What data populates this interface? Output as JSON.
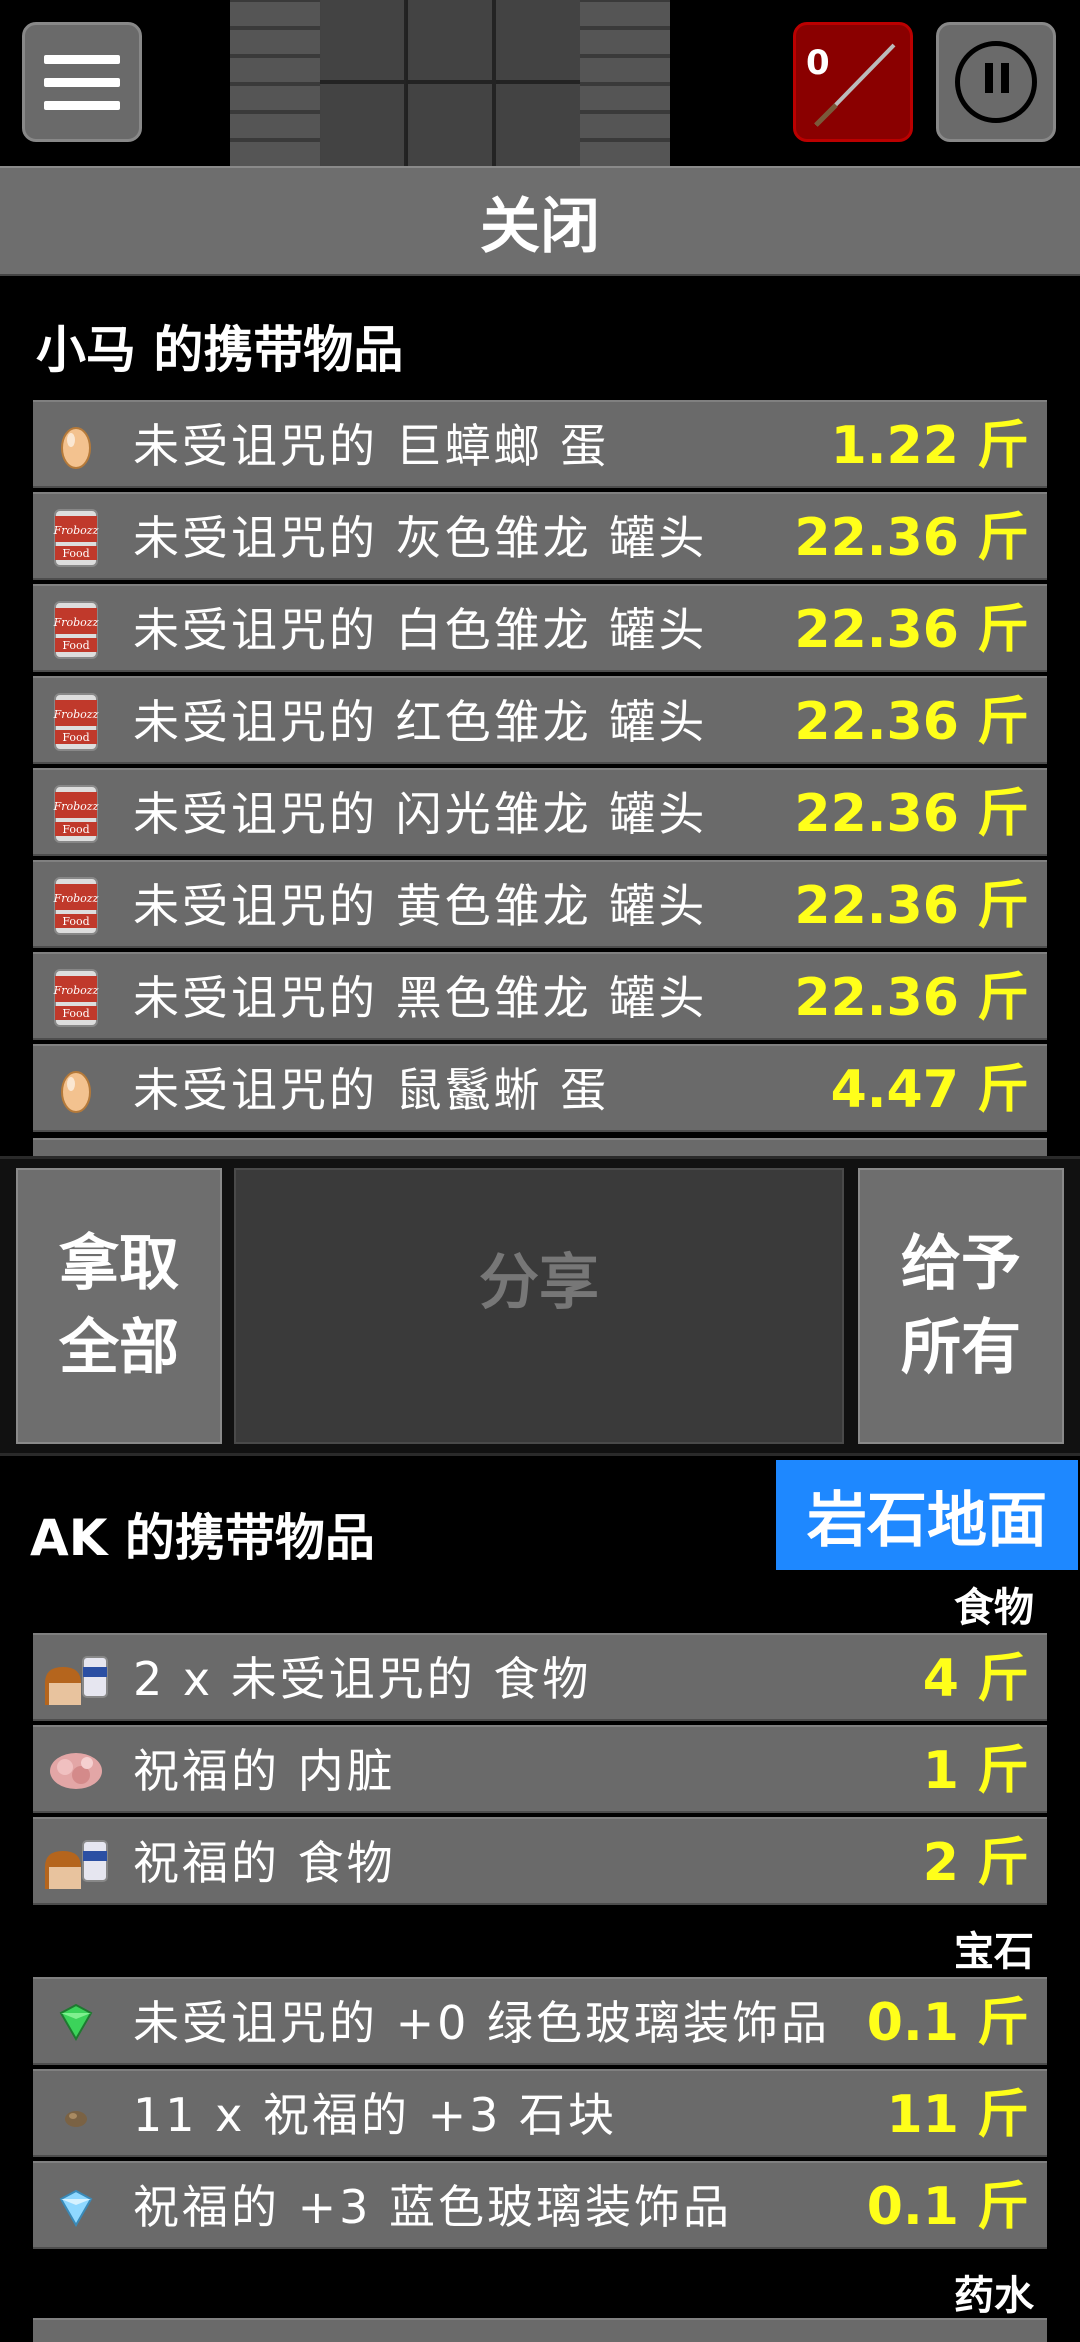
{
  "top_bar": {
    "weapon_count": "0",
    "menu_icon": "hamburger-menu-icon",
    "weapon_icon": "spear-icon",
    "pause_icon": "pause-icon"
  },
  "close_label": "关闭",
  "npc_inventory": {
    "title": "小马 的携带物品",
    "items": [
      {
        "icon": "egg-icon",
        "name": "未受诅咒的 巨蟑螂 蛋",
        "weight": "1.22 斤"
      },
      {
        "icon": "food-can-icon",
        "name": "未受诅咒的 灰色雏龙 罐头",
        "weight": "22.36 斤"
      },
      {
        "icon": "food-can-icon",
        "name": "未受诅咒的 白色雏龙 罐头",
        "weight": "22.36 斤"
      },
      {
        "icon": "food-can-icon",
        "name": "未受诅咒的 红色雏龙 罐头",
        "weight": "22.36 斤"
      },
      {
        "icon": "food-can-icon",
        "name": "未受诅咒的 闪光雏龙 罐头",
        "weight": "22.36 斤"
      },
      {
        "icon": "food-can-icon",
        "name": "未受诅咒的 黄色雏龙 罐头",
        "weight": "22.36 斤"
      },
      {
        "icon": "food-can-icon",
        "name": "未受诅咒的 黑色雏龙 罐头",
        "weight": "22.36 斤"
      },
      {
        "icon": "egg-icon",
        "name": "未受诅咒的 鼠鬣蜥 蛋",
        "weight": "4.47 斤"
      }
    ]
  },
  "actions": {
    "take_all": "拿取全部",
    "share": "分享",
    "give_all": "给予所有"
  },
  "player_inventory": {
    "title": "AK 的携带物品",
    "ground_button": "岩石地面",
    "categories": [
      {
        "label": "食物",
        "items": [
          {
            "icon": "bread-food-icon",
            "name": "2 x 未受诅咒的 食物",
            "weight": "4 斤"
          },
          {
            "icon": "entrails-icon",
            "name": "祝福的 内脏",
            "weight": "1 斤"
          },
          {
            "icon": "bread-food-icon",
            "name": "祝福的 食物",
            "weight": "2 斤"
          }
        ]
      },
      {
        "label": "宝石",
        "items": [
          {
            "icon": "green-gem-icon",
            "name": "未受诅咒的 +0 绿色玻璃装饰品",
            "weight": "0.1 斤"
          },
          {
            "icon": "rock-icon",
            "name": "11 x 祝福的 +3 石块",
            "weight": "11 斤"
          },
          {
            "icon": "blue-gem-icon",
            "name": "祝福的 +3 蓝色玻璃装饰品",
            "weight": "0.1 斤"
          }
        ]
      },
      {
        "label": "药水",
        "items": []
      }
    ]
  },
  "colors": {
    "weight": "#ffff1a",
    "ground_button": "#1e88ff",
    "weapon_button": "#8a0000"
  }
}
